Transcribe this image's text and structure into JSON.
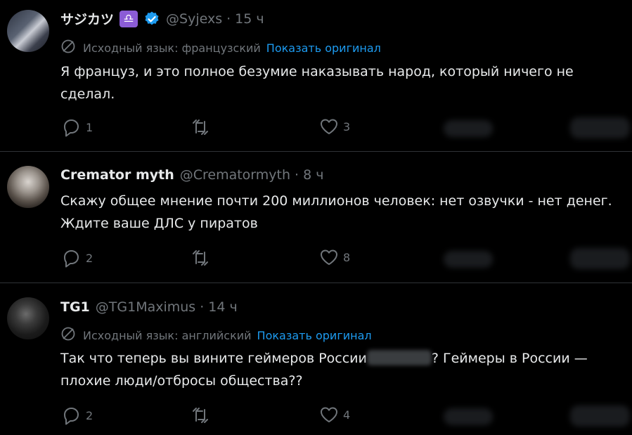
{
  "posts": [
    {
      "name": "サジカツ",
      "zodiac": "♎",
      "handle": "@Syjexs",
      "sep": "·",
      "time": "15 ч",
      "translation": {
        "label": "Исходный язык: французский",
        "link": "Показать оригинал"
      },
      "text": "Я француз, и это полное безумие наказывать народ, который ничего не сделал.",
      "replies": "1",
      "likes": "3",
      "verified": true
    },
    {
      "name": "Cremator myth",
      "handle": "@Crematormyth",
      "sep": "·",
      "time": "8 ч",
      "text": "Скажу общее мнение почти 200 миллионов человек: нет озвучки - нет денег. Ждите ваше ДЛС у пиратов",
      "replies": "2",
      "likes": "8"
    },
    {
      "name": "TG1",
      "handle": "@TG1Maximus",
      "sep": "·",
      "time": "14 ч",
      "translation": {
        "label": "Исходный язык: английский",
        "link": "Показать оригинал"
      },
      "text_before": "Так что теперь вы вините геймеров России",
      "text_after": "? Геймеры в России — плохие люди/отбросы общества??",
      "replies": "2",
      "likes": "4"
    }
  ],
  "icons": [
    "reply-icon",
    "retweet-icon",
    "like-icon",
    "verified-icon",
    "translate-icon"
  ],
  "colors": {
    "background": "#000000",
    "text": "#e7e9ea",
    "muted": "#71767b",
    "link": "#1d9bf0",
    "divider": "#2f3336",
    "zodiac_badge": "#8b5cd6"
  }
}
